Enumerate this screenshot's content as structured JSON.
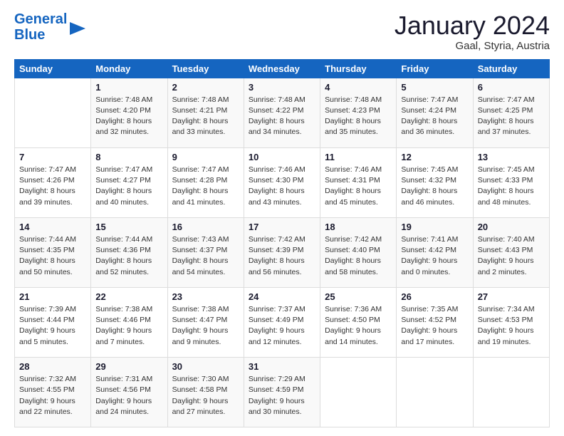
{
  "header": {
    "logo_line1": "General",
    "logo_line2": "Blue",
    "main_title": "January 2024",
    "subtitle": "Gaal, Styria, Austria"
  },
  "columns": [
    "Sunday",
    "Monday",
    "Tuesday",
    "Wednesday",
    "Thursday",
    "Friday",
    "Saturday"
  ],
  "weeks": [
    [
      {
        "day": "",
        "info": ""
      },
      {
        "day": "1",
        "info": "Sunrise: 7:48 AM\nSunset: 4:20 PM\nDaylight: 8 hours\nand 32 minutes."
      },
      {
        "day": "2",
        "info": "Sunrise: 7:48 AM\nSunset: 4:21 PM\nDaylight: 8 hours\nand 33 minutes."
      },
      {
        "day": "3",
        "info": "Sunrise: 7:48 AM\nSunset: 4:22 PM\nDaylight: 8 hours\nand 34 minutes."
      },
      {
        "day": "4",
        "info": "Sunrise: 7:48 AM\nSunset: 4:23 PM\nDaylight: 8 hours\nand 35 minutes."
      },
      {
        "day": "5",
        "info": "Sunrise: 7:47 AM\nSunset: 4:24 PM\nDaylight: 8 hours\nand 36 minutes."
      },
      {
        "day": "6",
        "info": "Sunrise: 7:47 AM\nSunset: 4:25 PM\nDaylight: 8 hours\nand 37 minutes."
      }
    ],
    [
      {
        "day": "7",
        "info": "Sunrise: 7:47 AM\nSunset: 4:26 PM\nDaylight: 8 hours\nand 39 minutes."
      },
      {
        "day": "8",
        "info": "Sunrise: 7:47 AM\nSunset: 4:27 PM\nDaylight: 8 hours\nand 40 minutes."
      },
      {
        "day": "9",
        "info": "Sunrise: 7:47 AM\nSunset: 4:28 PM\nDaylight: 8 hours\nand 41 minutes."
      },
      {
        "day": "10",
        "info": "Sunrise: 7:46 AM\nSunset: 4:30 PM\nDaylight: 8 hours\nand 43 minutes."
      },
      {
        "day": "11",
        "info": "Sunrise: 7:46 AM\nSunset: 4:31 PM\nDaylight: 8 hours\nand 45 minutes."
      },
      {
        "day": "12",
        "info": "Sunrise: 7:45 AM\nSunset: 4:32 PM\nDaylight: 8 hours\nand 46 minutes."
      },
      {
        "day": "13",
        "info": "Sunrise: 7:45 AM\nSunset: 4:33 PM\nDaylight: 8 hours\nand 48 minutes."
      }
    ],
    [
      {
        "day": "14",
        "info": "Sunrise: 7:44 AM\nSunset: 4:35 PM\nDaylight: 8 hours\nand 50 minutes."
      },
      {
        "day": "15",
        "info": "Sunrise: 7:44 AM\nSunset: 4:36 PM\nDaylight: 8 hours\nand 52 minutes."
      },
      {
        "day": "16",
        "info": "Sunrise: 7:43 AM\nSunset: 4:37 PM\nDaylight: 8 hours\nand 54 minutes."
      },
      {
        "day": "17",
        "info": "Sunrise: 7:42 AM\nSunset: 4:39 PM\nDaylight: 8 hours\nand 56 minutes."
      },
      {
        "day": "18",
        "info": "Sunrise: 7:42 AM\nSunset: 4:40 PM\nDaylight: 8 hours\nand 58 minutes."
      },
      {
        "day": "19",
        "info": "Sunrise: 7:41 AM\nSunset: 4:42 PM\nDaylight: 9 hours\nand 0 minutes."
      },
      {
        "day": "20",
        "info": "Sunrise: 7:40 AM\nSunset: 4:43 PM\nDaylight: 9 hours\nand 2 minutes."
      }
    ],
    [
      {
        "day": "21",
        "info": "Sunrise: 7:39 AM\nSunset: 4:44 PM\nDaylight: 9 hours\nand 5 minutes."
      },
      {
        "day": "22",
        "info": "Sunrise: 7:38 AM\nSunset: 4:46 PM\nDaylight: 9 hours\nand 7 minutes."
      },
      {
        "day": "23",
        "info": "Sunrise: 7:38 AM\nSunset: 4:47 PM\nDaylight: 9 hours\nand 9 minutes."
      },
      {
        "day": "24",
        "info": "Sunrise: 7:37 AM\nSunset: 4:49 PM\nDaylight: 9 hours\nand 12 minutes."
      },
      {
        "day": "25",
        "info": "Sunrise: 7:36 AM\nSunset: 4:50 PM\nDaylight: 9 hours\nand 14 minutes."
      },
      {
        "day": "26",
        "info": "Sunrise: 7:35 AM\nSunset: 4:52 PM\nDaylight: 9 hours\nand 17 minutes."
      },
      {
        "day": "27",
        "info": "Sunrise: 7:34 AM\nSunset: 4:53 PM\nDaylight: 9 hours\nand 19 minutes."
      }
    ],
    [
      {
        "day": "28",
        "info": "Sunrise: 7:32 AM\nSunset: 4:55 PM\nDaylight: 9 hours\nand 22 minutes."
      },
      {
        "day": "29",
        "info": "Sunrise: 7:31 AM\nSunset: 4:56 PM\nDaylight: 9 hours\nand 24 minutes."
      },
      {
        "day": "30",
        "info": "Sunrise: 7:30 AM\nSunset: 4:58 PM\nDaylight: 9 hours\nand 27 minutes."
      },
      {
        "day": "31",
        "info": "Sunrise: 7:29 AM\nSunset: 4:59 PM\nDaylight: 9 hours\nand 30 minutes."
      },
      {
        "day": "",
        "info": ""
      },
      {
        "day": "",
        "info": ""
      },
      {
        "day": "",
        "info": ""
      }
    ]
  ]
}
